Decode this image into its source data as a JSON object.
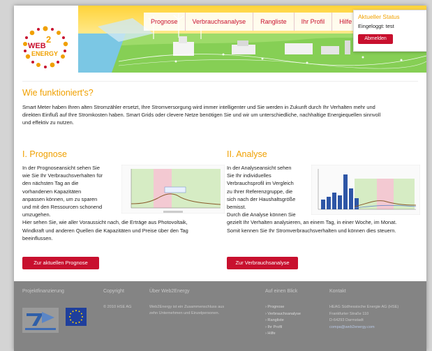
{
  "header": {
    "logo_text": [
      "WEB",
      "2",
      "ENERGY"
    ],
    "nav": [
      "Prognose",
      "Verbrauchsanalyse",
      "Rangliste",
      "Ihr Profil",
      "Hilfe"
    ],
    "status": {
      "title": "Aktueller Status",
      "user": "Eingeloggt: test",
      "logout": "Abmelden"
    }
  },
  "intro": {
    "title": "Wie funktioniert's?",
    "lines": [
      "Smart Meter haben Ihren alten Stromzähler ersetzt, Ihre Stromversorgung wird immer intelligenter und Sie werden in Zukunft durch Ihr Verhalten  mehr und",
      "direkten Einfluß auf Ihre Stromkosten haben. Smart Grids oder clevere Netze benötigen Sie und wir um unterschiedliche, nachhaltige Energiequellen sinnvoll",
      "und effektiv zu nutzen."
    ]
  },
  "prognose": {
    "title": "I. Prognose",
    "lines": [
      "In der Prognoseansicht sehen Sie",
      "wie Sie Ihr Verbrauchsverhalten für",
      "den nächsten Tag an die",
      "vorhandenen Kapazitäten",
      "anpassen können, um zu sparen",
      "und mit den Ressourcen schonend",
      "umzugehen.",
      "Hier sehen Sie, wie aller Voraussicht nach, die Erträge aus Photovoltaik,",
      "Windkraft und anderen Quellen die Kapazitäten und Preise über den Tag",
      "beeinflussen."
    ],
    "button": "Zur aktuellen Prognose"
  },
  "analyse": {
    "title": "II. Analyse",
    "lines": [
      "In der Analyseansicht sehen",
      "Sie Ihr individuelles",
      "Verbrauchsprofil im Vergleich",
      "zu Ihrer Referenzgruppe, die",
      "sich nach der Haushaltsgröße",
      "bemisst.",
      "Durch die Analyse können Sie",
      "gezielt Ihr Verhalten analysieren, an einem Tag, in einer Woche, im Monat.",
      "Somit kennen Sie Ihr Stromverbrauchsverhalten und können dies steuern."
    ],
    "button": "Zur Verbrauchsanalyse"
  },
  "footer": {
    "headings": [
      "Projektfinanzierung",
      "Copyright",
      "Über Web2Energy",
      "Auf einen Blick",
      "Kontakt"
    ],
    "copyright": "© 2010 HSE AG",
    "about": [
      "Web2Energy ist ein Zusammenschluss aus",
      "zehn Unternehmen und Einzelpersonen."
    ],
    "links": [
      "› Prognose",
      "› Verbrauchsanalyse",
      "› Rangliste",
      "› Ihr Profil",
      "› Hilfe"
    ],
    "contact": [
      "HEAG Südhessische Energie AG (HSE)",
      "Frankfurter Straße 110",
      "D-64293 Darmstadt"
    ],
    "contact_email": "compa@web2energy.com"
  },
  "colors": {
    "accent_red": "#c8102e",
    "accent_orange": "#f0a000",
    "footer_bg": "#848484"
  }
}
